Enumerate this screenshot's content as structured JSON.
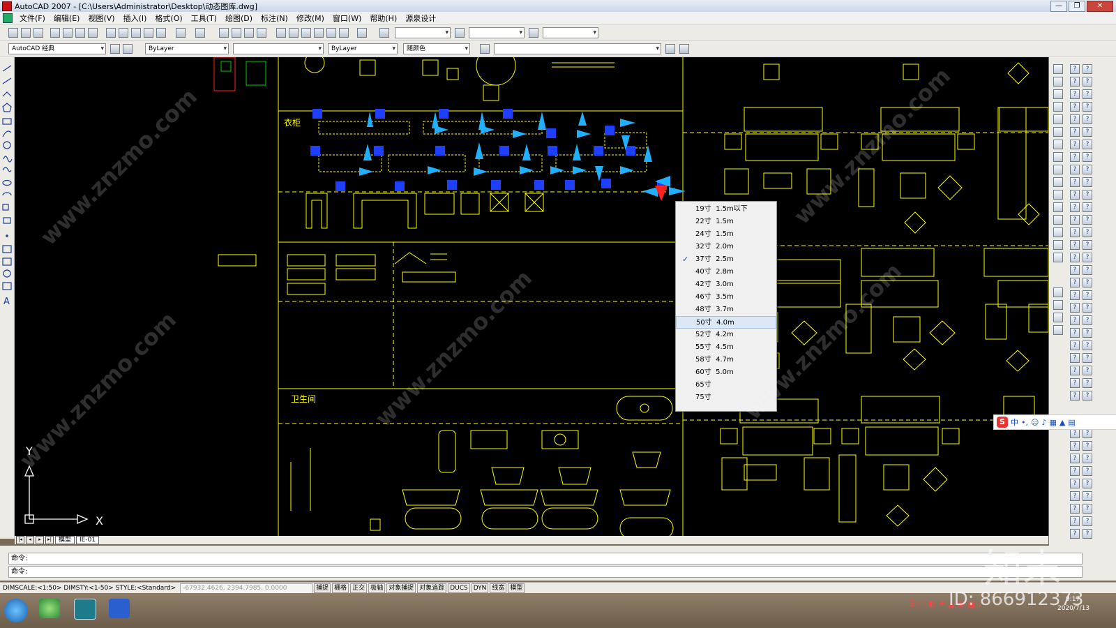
{
  "window": {
    "title": "AutoCAD 2007 - [C:\\Users\\Administrator\\Desktop\\动态图库.dwg]",
    "controls": [
      "—",
      "❐",
      "✕"
    ]
  },
  "menu": [
    "文件(F)",
    "编辑(E)",
    "视图(V)",
    "插入(I)",
    "格式(O)",
    "工具(T)",
    "绘图(D)",
    "标注(N)",
    "修改(M)",
    "窗口(W)",
    "帮助(H)",
    "源泉设计"
  ],
  "toolbar": {
    "workspace": "AutoCAD 经典",
    "layer_color": "ByLayer",
    "linetype": "ByLayer",
    "lineweight_color": "随颜色"
  },
  "drawing": {
    "wardrobe_label": "衣柜",
    "bathroom_label": "卫生间",
    "axis_x": "X",
    "axis_y": "Y"
  },
  "layout_tabs": [
    "模型",
    "IE-01"
  ],
  "context_menu": {
    "items": [
      "19寸  1.5m以下",
      "22寸  1.5m",
      "24寸  1.5m",
      "32寸  2.0m",
      "37寸  2.5m",
      "40寸  2.8m",
      "42寸  3.0m",
      "46寸  3.5m",
      "48寸  3.7m",
      "50寸  4.0m",
      "52寸  4.2m",
      "55寸  4.5m",
      "58寸  4.7m",
      "60寸  5.0m",
      "65寸",
      "75寸"
    ],
    "checked_item": "37寸  2.5m",
    "highlighted_item": "50寸  4.0m"
  },
  "command": {
    "line1": "命令:",
    "line2": "命令:"
  },
  "status": {
    "text": "DIMSCALE:<1:50> DIMSTY:<1-50> STYLE:<Standard>",
    "coordinates": "-67932.4626, 2394.7985, 0.0000",
    "buttons": [
      "捕捉",
      "栅格",
      "正交",
      "极轴",
      "对象捕捉",
      "对象追踪",
      "DUCS",
      "DYN",
      "线宽",
      "模型"
    ]
  },
  "ime": {
    "label": "中"
  },
  "taskbar": {
    "time": "9:17",
    "date": "2020/7/13"
  },
  "watermark": {
    "id_text": "ID: 866912373",
    "brand": "知末",
    "site": "www.znzmo.com"
  }
}
